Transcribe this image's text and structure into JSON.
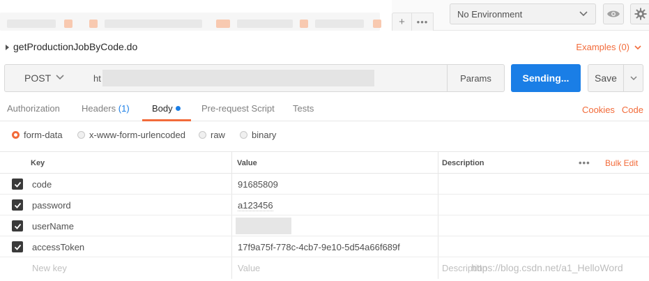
{
  "environment": {
    "selected": "No Environment"
  },
  "tabstrip": {
    "add_label": "+",
    "more_label": "•••"
  },
  "request": {
    "name": "getProductionJobByCode.do",
    "examples_label": "Examples (0)"
  },
  "url_bar": {
    "method": "POST",
    "url_prefix": "ht",
    "params_label": "Params",
    "send_label": "Sending...",
    "save_label": "Save"
  },
  "subtabs": {
    "authorization": "Authorization",
    "headers": "Headers",
    "headers_count": "(1)",
    "body": "Body",
    "prerequest": "Pre-request Script",
    "tests": "Tests",
    "cookies": "Cookies",
    "code": "Code"
  },
  "body_types": {
    "form_data": "form-data",
    "urlencoded": "x-www-form-urlencoded",
    "raw": "raw",
    "binary": "binary",
    "selected": "form-data"
  },
  "table": {
    "headers": {
      "key": "Key",
      "value": "Value",
      "description": "Description",
      "bulk_edit": "Bulk Edit"
    },
    "rows": [
      {
        "key": "code",
        "value": "91685809",
        "checked": true
      },
      {
        "key": "password",
        "value": "a123456",
        "checked": true
      },
      {
        "key": "userName",
        "value": "",
        "checked": true
      },
      {
        "key": "accessToken",
        "value": "17f9a75f-778c-4cb7-9e10-5d54a66f689f",
        "checked": true
      }
    ],
    "new_row": {
      "key_placeholder": "New key",
      "value_placeholder": "Value",
      "description_placeholder": "Description"
    }
  },
  "watermark": "https://blog.csdn.net/a1_HelloWord",
  "colors": {
    "accent": "#f26b3a",
    "primary": "#1a7ee6"
  }
}
